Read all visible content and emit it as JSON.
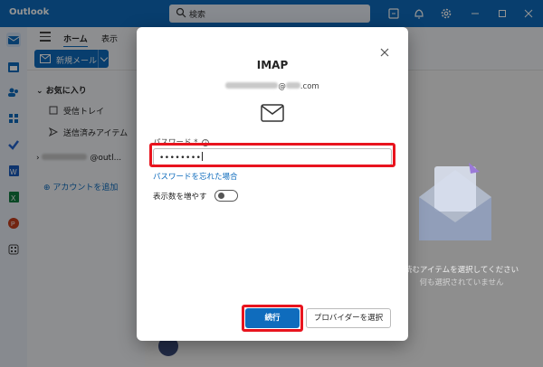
{
  "app": {
    "title": "Outlook"
  },
  "search": {
    "placeholder": "検索"
  },
  "ribbon": {
    "tabs": [
      "ホーム",
      "表示"
    ],
    "new_mail": "新規メール"
  },
  "nav": {
    "favorites": "お気に入り",
    "items": [
      "受信トレイ",
      "送信済みアイテム"
    ],
    "account_suffix": "@outl...",
    "add_account": "アカウントを追加"
  },
  "empty_state": {
    "title": "読むアイテムを選択してください",
    "subtitle": "何も選択されていません"
  },
  "dialog": {
    "title": "IMAP",
    "email_suffix": "@",
    "email_domain_suffix": ".com",
    "password_label": "パスワード",
    "password_value": "••••••••",
    "forgot_link": "パスワードを忘れた場合",
    "show_more_label": "表示数を増やす",
    "show_more_on": false,
    "continue_button": "続行",
    "provider_button": "プロバイダーを選択"
  },
  "colors": {
    "accent": "#0f6cbd",
    "highlight": "#e8141e"
  }
}
